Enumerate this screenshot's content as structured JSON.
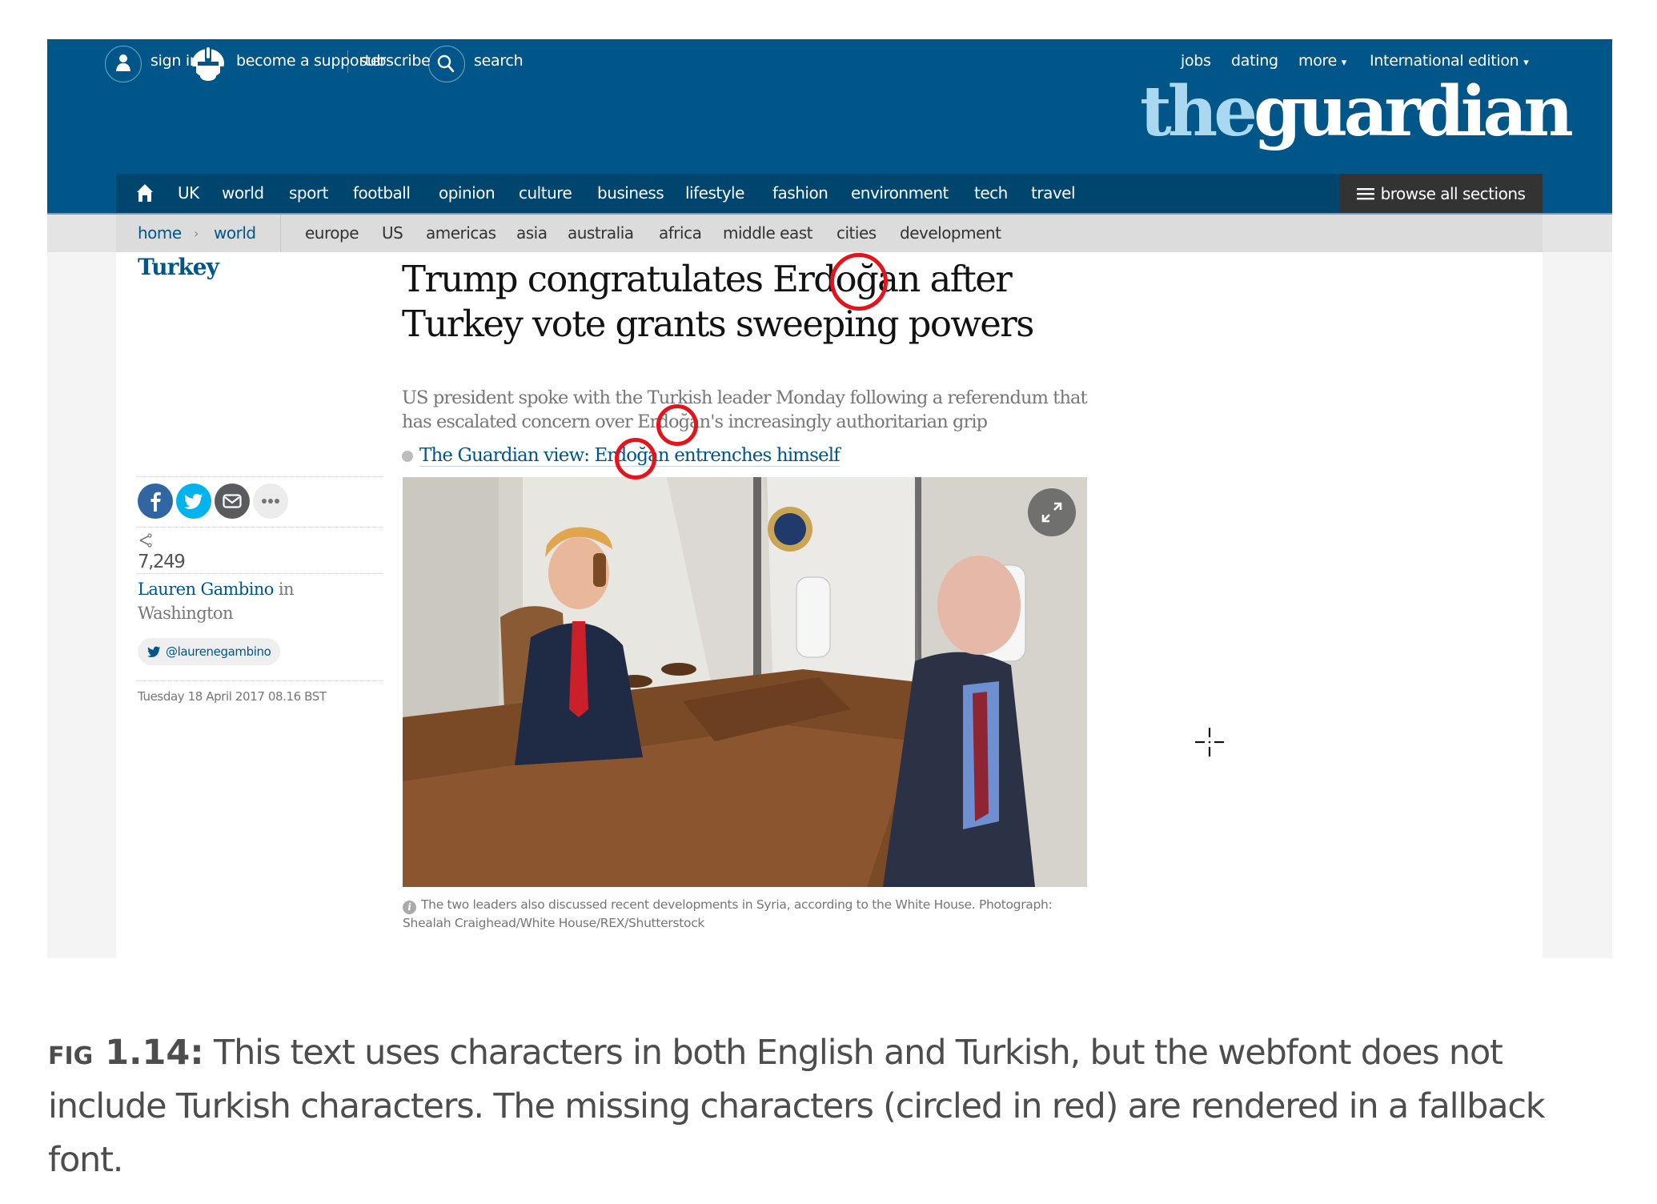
{
  "top_bar": {
    "sign_in": "sign in",
    "become_supporter": "become a supporter",
    "subscribe": "subscribe",
    "search": "search",
    "jobs": "jobs",
    "dating": "dating",
    "more": "more",
    "edition": "International edition",
    "logo_the": "the",
    "logo_guardian": "guardian",
    "dropdown_glyph": "▾"
  },
  "nav": {
    "items": [
      "UK",
      "world",
      "sport",
      "football",
      "opinion",
      "culture",
      "business",
      "lifestyle",
      "fashion",
      "environment",
      "tech",
      "travel"
    ],
    "browse_all": "browse all sections"
  },
  "subnav": {
    "breadcrumb": [
      "home",
      "world"
    ],
    "breadcrumb_sep": "›",
    "items": [
      "europe",
      "US",
      "americas",
      "asia",
      "australia",
      "africa",
      "middle east",
      "cities",
      "development"
    ]
  },
  "article": {
    "kicker": "Turkey",
    "headline_line1": "Trump congratulates Erdoğan after",
    "headline_line2": "Turkey vote grants sweeping powers",
    "standfirst_line1": "US president spoke with the Turkish leader Monday following a referendum that",
    "standfirst_line2": "has escalated concern over Erdoğan's increasingly authoritarian grip",
    "related_link": "The Guardian view: Erdoğan entrenches himself",
    "image_caption": "The two leaders also discussed recent developments in Syria, according to the White House. Photograph: Shealah Craighead/White House/REX/Shutterstock",
    "info_glyph": "i"
  },
  "meta": {
    "share_count": "7,249",
    "author": "Lauren Gambino",
    "author_location_prefix": " in",
    "author_location": "Washington",
    "twitter_handle": "@laurenegambino",
    "dateline": "Tuesday 18 April 2017 08.16 BST"
  },
  "colors": {
    "guardian_blue": "#005689",
    "nav_dark_blue": "#00456e",
    "highlight_red": "#e3141b",
    "facebook": "#3067a3",
    "twitter": "#03b3ee",
    "email": "#595c5f"
  },
  "figure": {
    "label": "fig 1.14:",
    "text": " This text uses characters in both English and Turkish, but the webfont does not include Turkish characters. The missing characters (circled in red) are rendered in a fallback font."
  }
}
